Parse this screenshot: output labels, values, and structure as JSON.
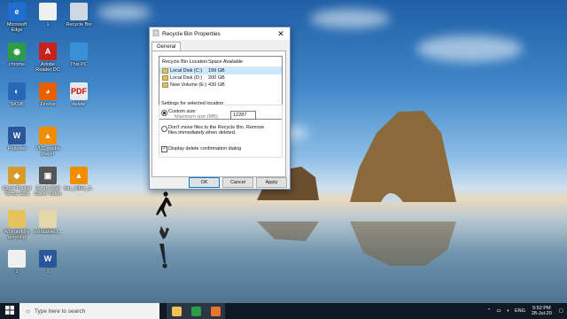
{
  "desktop": {
    "icons": [
      {
        "label": "Microsoft Edge",
        "icon": "edge-icon",
        "color": "#1e6fd0",
        "glyph": "e"
      },
      {
        "label": "1",
        "icon": "file-icon",
        "color": "#f0f0f0",
        "glyph": ""
      },
      {
        "label": "Recycle Bin",
        "icon": "recycle-bin-icon",
        "color": "#cfd8e2",
        "glyph": ""
      },
      {
        "label": "chrome",
        "icon": "chrome-icon",
        "color": "#2e9b46",
        "glyph": "◉"
      },
      {
        "label": "Adobe Reader DC",
        "icon": "adobe-reader-icon",
        "color": "#c8201d",
        "glyph": "A"
      },
      {
        "label": "This PC",
        "icon": "this-pc-icon",
        "color": "#3a8fd6",
        "glyph": ""
      },
      {
        "label": "SKSB",
        "icon": "app-icon",
        "color": "#2868b8",
        "glyph": "◐"
      },
      {
        "label": "Firefox",
        "icon": "firefox-icon",
        "color": "#e66000",
        "glyph": "◕"
      },
      {
        "label": "delete",
        "icon": "pdf-icon",
        "color": "#e9e9e9",
        "glyph": "PDF"
      },
      {
        "label": "Resume",
        "icon": "word-doc-icon",
        "color": "#2b579a",
        "glyph": "W"
      },
      {
        "label": "VLC media player",
        "icon": "vlc-icon",
        "color": "#f28c00",
        "glyph": "▲"
      },
      {
        "label": "Clone Pocket Terms Sold",
        "icon": "app-icon",
        "color": "#d89a2a",
        "glyph": "◆"
      },
      {
        "label": "Sandy Wall Cover Video",
        "icon": "app-icon",
        "color": "#555555",
        "glyph": "▣"
      },
      {
        "label": "bar_video_3...",
        "icon": "vlc-icon",
        "color": "#f28c00",
        "glyph": "▲"
      },
      {
        "label": "Wonderfully greeting",
        "icon": "folder-icon",
        "color": "#e7c15c",
        "glyph": ""
      },
      {
        "label": "extraabject...",
        "icon": "file-icon",
        "color": "#e6d6a6",
        "glyph": ""
      },
      {
        "label": "1",
        "icon": "file-icon",
        "color": "#f0f0f0",
        "glyph": ""
      },
      {
        "label": "1",
        "icon": "word-doc-icon",
        "color": "#2b579a",
        "glyph": "W"
      }
    ]
  },
  "dialog": {
    "title": "Recycle Bin Properties",
    "tab": "General",
    "columns": [
      "Recycle Bin Location",
      "Space Available"
    ],
    "rows": [
      {
        "location": "Local Disk (C:)",
        "space": "199 GB",
        "selected": true
      },
      {
        "location": "Local Disk (D:)",
        "space": "200 GB",
        "selected": false
      },
      {
        "location": "New Volume (E:)",
        "space": "430 GB",
        "selected": false
      }
    ],
    "settings_label": "Settings for selected location",
    "custom_size_label": "Custom size:",
    "max_size_label": "Maximum size (MB):",
    "max_size_value": "12287",
    "dont_move_label": "Don't move files to the Recycle Bin. Remove files immediately when deleted.",
    "display_confirm_label": "Display delete confirmation dialog",
    "display_confirm_checked": true,
    "ok": "OK",
    "cancel": "Cancel",
    "apply": "Apply"
  },
  "taskbar": {
    "search_placeholder": "Type here to search",
    "time": "5:52 PM",
    "date": "28-Jul-20",
    "accent": "#101a24"
  }
}
